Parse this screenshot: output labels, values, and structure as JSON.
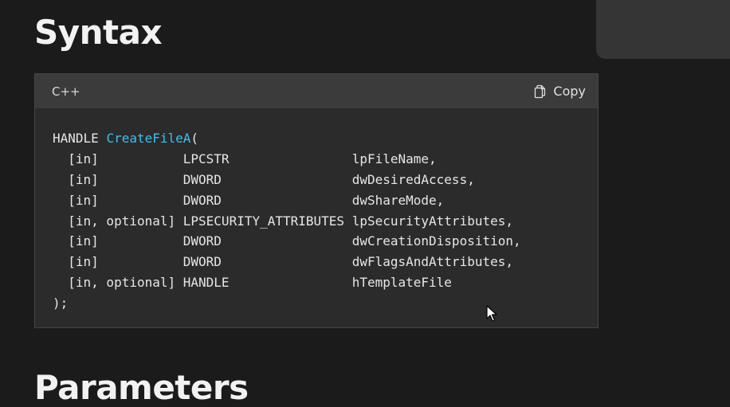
{
  "page": {
    "syntax_heading": "Syntax",
    "parameters_heading": "Parameters"
  },
  "code_block": {
    "language": "C++",
    "copy_label": "Copy",
    "copy_icon": "copy-icon",
    "signature_prefix": "HANDLE ",
    "function_name": "CreateFileA",
    "open_paren": "(",
    "closing": ");",
    "params": [
      {
        "annotation": "[in]",
        "type": "LPCSTR",
        "name": "lpFileName,"
      },
      {
        "annotation": "[in]",
        "type": "DWORD",
        "name": "dwDesiredAccess,"
      },
      {
        "annotation": "[in]",
        "type": "DWORD",
        "name": "dwShareMode,"
      },
      {
        "annotation": "[in, optional]",
        "type": "LPSECURITY_ATTRIBUTES",
        "name": "lpSecurityAttributes,"
      },
      {
        "annotation": "[in]",
        "type": "DWORD",
        "name": "dwCreationDisposition,"
      },
      {
        "annotation": "[in]",
        "type": "DWORD",
        "name": "dwFlagsAndAttributes,"
      },
      {
        "annotation": "[in, optional]",
        "type": "HANDLE",
        "name": "hTemplateFile"
      }
    ]
  },
  "colors": {
    "background": "#1b1b1b",
    "code_background": "#2b2b2b",
    "header_background": "#3b3b3b",
    "function_name": "#3bc0f0"
  }
}
